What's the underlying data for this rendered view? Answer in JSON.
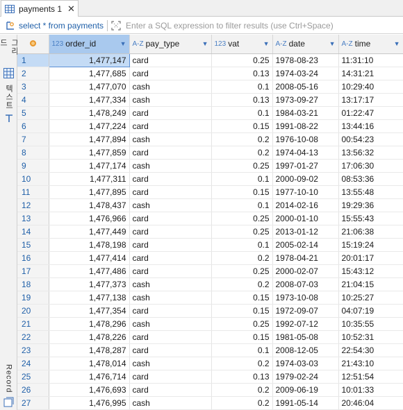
{
  "tab": {
    "title": "payments 1",
    "close": "✕"
  },
  "filter": {
    "sql": "select * from payments",
    "placeholder": "Enter a SQL expression to filter results (use Ctrl+Space)"
  },
  "sidebar": {
    "grid_label": "그리드",
    "text_label": "텍스트",
    "record_label": "Record"
  },
  "columns": [
    {
      "type": "123",
      "name": "order_id"
    },
    {
      "type": "A-Z",
      "name": "pay_type"
    },
    {
      "type": "123",
      "name": "vat"
    },
    {
      "type": "A-Z",
      "name": "date"
    },
    {
      "type": "A-Z",
      "name": "time"
    }
  ],
  "rows": [
    {
      "n": "1",
      "order_id": "1,477,147",
      "pay_type": "card",
      "vat": "0.25",
      "date": "1978-08-23",
      "time": "11:31:10"
    },
    {
      "n": "2",
      "order_id": "1,477,685",
      "pay_type": "card",
      "vat": "0.13",
      "date": "1974-03-24",
      "time": "14:31:21"
    },
    {
      "n": "3",
      "order_id": "1,477,070",
      "pay_type": "cash",
      "vat": "0.1",
      "date": "2008-05-16",
      "time": "10:29:40"
    },
    {
      "n": "4",
      "order_id": "1,477,334",
      "pay_type": "cash",
      "vat": "0.13",
      "date": "1973-09-27",
      "time": "13:17:17"
    },
    {
      "n": "5",
      "order_id": "1,478,249",
      "pay_type": "card",
      "vat": "0.1",
      "date": "1984-03-21",
      "time": "01:22:47"
    },
    {
      "n": "6",
      "order_id": "1,477,224",
      "pay_type": "card",
      "vat": "0.15",
      "date": "1991-08-22",
      "time": "13:44:16"
    },
    {
      "n": "7",
      "order_id": "1,477,894",
      "pay_type": "cash",
      "vat": "0.2",
      "date": "1976-10-08",
      "time": "00:54:23"
    },
    {
      "n": "8",
      "order_id": "1,477,859",
      "pay_type": "card",
      "vat": "0.2",
      "date": "1974-04-13",
      "time": "13:56:32"
    },
    {
      "n": "9",
      "order_id": "1,477,174",
      "pay_type": "cash",
      "vat": "0.25",
      "date": "1997-01-27",
      "time": "17:06:30"
    },
    {
      "n": "10",
      "order_id": "1,477,311",
      "pay_type": "card",
      "vat": "0.1",
      "date": "2000-09-02",
      "time": "08:53:36"
    },
    {
      "n": "11",
      "order_id": "1,477,895",
      "pay_type": "card",
      "vat": "0.15",
      "date": "1977-10-10",
      "time": "13:55:48"
    },
    {
      "n": "12",
      "order_id": "1,478,437",
      "pay_type": "cash",
      "vat": "0.1",
      "date": "2014-02-16",
      "time": "19:29:36"
    },
    {
      "n": "13",
      "order_id": "1,476,966",
      "pay_type": "card",
      "vat": "0.25",
      "date": "2000-01-10",
      "time": "15:55:43"
    },
    {
      "n": "14",
      "order_id": "1,477,449",
      "pay_type": "card",
      "vat": "0.25",
      "date": "2013-01-12",
      "time": "21:06:38"
    },
    {
      "n": "15",
      "order_id": "1,478,198",
      "pay_type": "card",
      "vat": "0.1",
      "date": "2005-02-14",
      "time": "15:19:24"
    },
    {
      "n": "16",
      "order_id": "1,477,414",
      "pay_type": "card",
      "vat": "0.2",
      "date": "1978-04-21",
      "time": "20:01:17"
    },
    {
      "n": "17",
      "order_id": "1,477,486",
      "pay_type": "card",
      "vat": "0.25",
      "date": "2000-02-07",
      "time": "15:43:12"
    },
    {
      "n": "18",
      "order_id": "1,477,373",
      "pay_type": "cash",
      "vat": "0.2",
      "date": "2008-07-03",
      "time": "21:04:15"
    },
    {
      "n": "19",
      "order_id": "1,477,138",
      "pay_type": "cash",
      "vat": "0.15",
      "date": "1973-10-08",
      "time": "10:25:27"
    },
    {
      "n": "20",
      "order_id": "1,477,354",
      "pay_type": "card",
      "vat": "0.15",
      "date": "1972-09-07",
      "time": "04:07:19"
    },
    {
      "n": "21",
      "order_id": "1,478,296",
      "pay_type": "cash",
      "vat": "0.25",
      "date": "1992-07-12",
      "time": "10:35:55"
    },
    {
      "n": "22",
      "order_id": "1,478,226",
      "pay_type": "card",
      "vat": "0.15",
      "date": "1981-05-08",
      "time": "10:52:31"
    },
    {
      "n": "23",
      "order_id": "1,478,287",
      "pay_type": "card",
      "vat": "0.1",
      "date": "2008-12-05",
      "time": "22:54:30"
    },
    {
      "n": "24",
      "order_id": "1,478,014",
      "pay_type": "cash",
      "vat": "0.2",
      "date": "1974-03-03",
      "time": "21:43:10"
    },
    {
      "n": "25",
      "order_id": "1,476,714",
      "pay_type": "card",
      "vat": "0.13",
      "date": "1979-02-24",
      "time": "12:51:54"
    },
    {
      "n": "26",
      "order_id": "1,476,693",
      "pay_type": "card",
      "vat": "0.2",
      "date": "2009-06-19",
      "time": "10:01:33"
    },
    {
      "n": "27",
      "order_id": "1,476,995",
      "pay_type": "cash",
      "vat": "0.2",
      "date": "1991-05-14",
      "time": "20:46:04"
    }
  ]
}
